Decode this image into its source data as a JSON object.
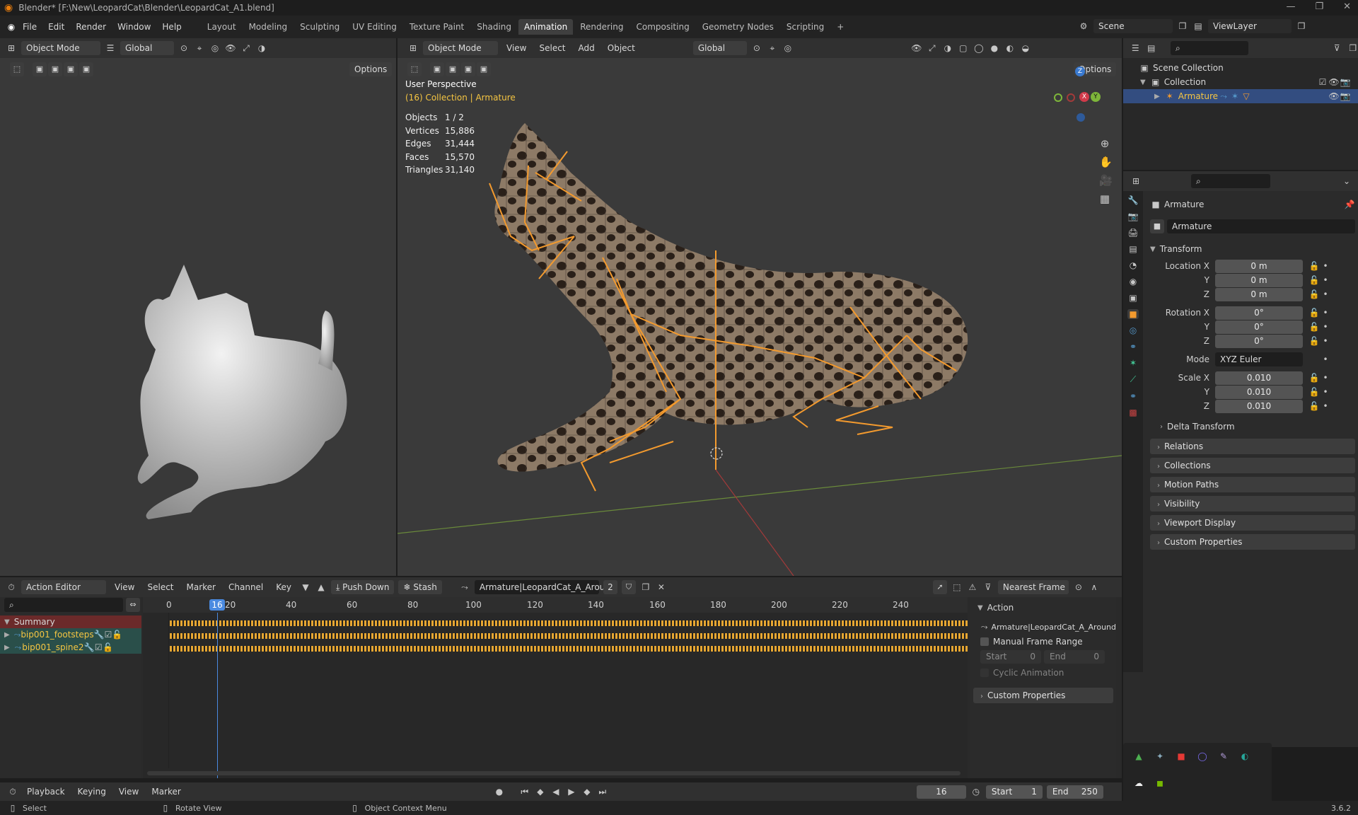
{
  "window": {
    "title": "Blender* [F:\\New\\LeopardCat\\Blender\\LeopardCat_A1.blend]"
  },
  "menu": [
    "File",
    "Edit",
    "Render",
    "Window",
    "Help"
  ],
  "workspaces": [
    "Layout",
    "Modeling",
    "Sculpting",
    "UV Editing",
    "Texture Paint",
    "Shading",
    "Animation",
    "Rendering",
    "Compositing",
    "Geometry Nodes",
    "Scripting"
  ],
  "scene": {
    "label": "Scene",
    "viewlayer": "ViewLayer"
  },
  "left_viewport": {
    "mode": "Object Mode",
    "orientation": "Global",
    "options": "Options"
  },
  "main_viewport": {
    "mode": "Object Mode",
    "menus": [
      "View",
      "Select",
      "Add",
      "Object"
    ],
    "orientation": "Global",
    "options": "Options",
    "perspective": "User Perspective",
    "context": "(16) Collection | Armature",
    "stats": [
      {
        "k": "Objects",
        "v": "1 / 2"
      },
      {
        "k": "Vertices",
        "v": "15,886"
      },
      {
        "k": "Edges",
        "v": "31,444"
      },
      {
        "k": "Faces",
        "v": "15,570"
      },
      {
        "k": "Triangles",
        "v": "31,140"
      }
    ]
  },
  "outliner": {
    "scene_collection": "Scene Collection",
    "collection": "Collection",
    "armature": "Armature"
  },
  "properties": {
    "object_name": "Armature",
    "data_name": "Armature",
    "transform": "Transform",
    "location": {
      "label": "Location X",
      "x": "0 m",
      "y": "0 m",
      "z": "0 m"
    },
    "rotation": {
      "label": "Rotation X",
      "x": "0°",
      "y": "0°",
      "z": "0°"
    },
    "mode": {
      "label": "Mode",
      "value": "XYZ Euler"
    },
    "scale": {
      "label": "Scale X",
      "x": "0.010",
      "y": "0.010",
      "z": "0.010"
    },
    "axis_y": "Y",
    "axis_z": "Z",
    "delta": "Delta Transform",
    "panels": [
      "Relations",
      "Collections",
      "Motion Paths",
      "Visibility",
      "Viewport Display",
      "Custom Properties"
    ]
  },
  "action_editor": {
    "mode": "Action Editor",
    "menus": [
      "View",
      "Select",
      "Marker",
      "Channel",
      "Key"
    ],
    "push_down": "Push Down",
    "stash": "Stash",
    "action": "Armature|LeopardCat_A_Around",
    "users": "2",
    "snap": "Nearest Frame",
    "channels": [
      {
        "name": "Summary"
      },
      {
        "name": "bip001_footsteps"
      },
      {
        "name": "bip001_spine2"
      }
    ],
    "ruler": [
      "0",
      "20",
      "40",
      "60",
      "80",
      "100",
      "120",
      "140",
      "160",
      "180",
      "200",
      "220",
      "240"
    ],
    "current_frame": "16",
    "sidebar": {
      "header": "Action",
      "action": "Armature|LeopardCat_A_Around",
      "manual_range": "Manual Frame Range",
      "start_label": "Start",
      "start": "0",
      "end_label": "End",
      "end": "0",
      "cyclic": "Cyclic Animation",
      "custom": "Custom Properties"
    }
  },
  "timeline": {
    "menus": [
      "Playback",
      "Keying",
      "View",
      "Marker"
    ],
    "frame": "16",
    "start_label": "Start",
    "start": "1",
    "end_label": "End",
    "end": "250"
  },
  "statusbar": {
    "select": "Select",
    "rotate": "Rotate View",
    "context": "Object Context Menu",
    "version": "3.6.2"
  }
}
